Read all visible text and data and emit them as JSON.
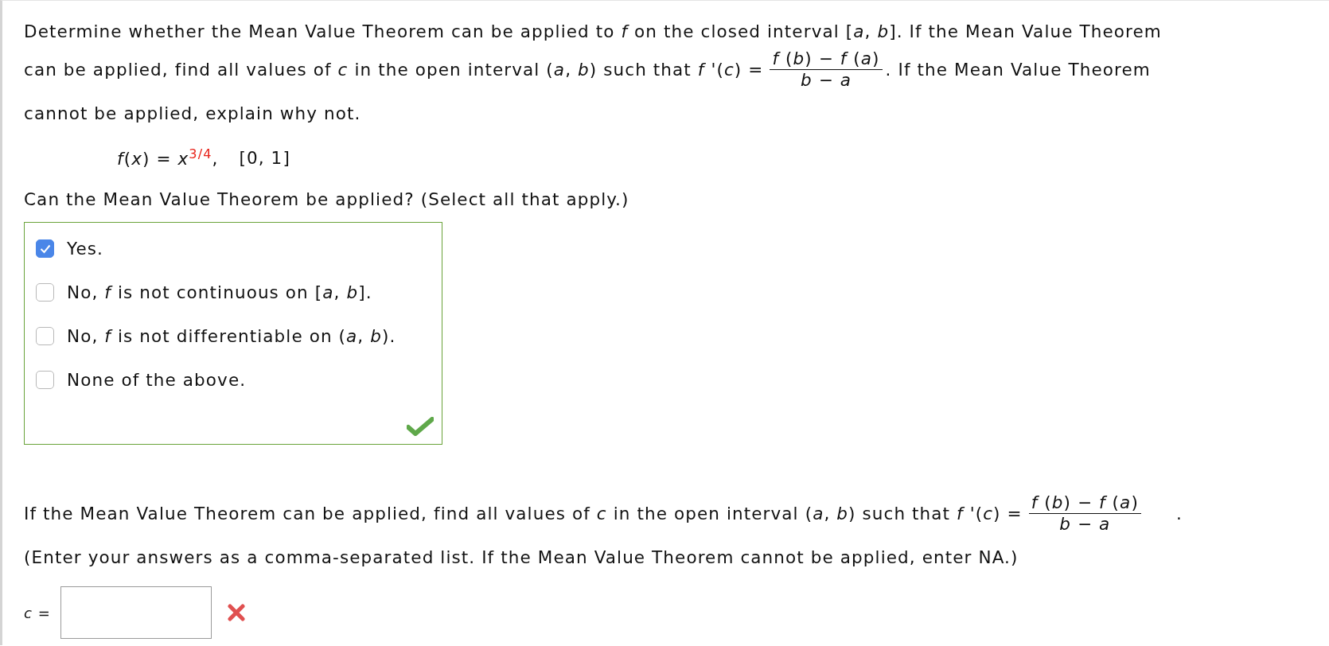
{
  "question": {
    "line_1": "Determine whether the Mean Value Theorem can be applied to *f* on the closed interval [*a*, *b*]. If the Mean Value Theorem",
    "line_2_before": "can be applied, find all values of *c* in the open interval (*a*, *b*) such that  *f* '(*c*) =",
    "fraction": {
      "numerator": "*f* (*b*) − *f* (*a*)",
      "denominator": "*b* − *a*"
    },
    "line_2_after": ".  If the Mean Value Theorem",
    "line_3": "cannot be applied, explain why not."
  },
  "function": {
    "formula": "*f*(*x*) = *x*$^{3/4}$,",
    "interval": "[0, 1]"
  },
  "part1": {
    "prompt": "Can the Mean Value Theorem be applied? (Select all that apply.)",
    "correct": true,
    "options": [
      {
        "label": "Yes.",
        "checked": true
      },
      {
        "label": "No, *f* is not continuous on [*a*, *b*].",
        "checked": false
      },
      {
        "label": "No, *f* is not differentiable on (*a*, *b*).",
        "checked": false
      },
      {
        "label": "None of the above.",
        "checked": false
      }
    ]
  },
  "part2": {
    "before": "If the Mean Value Theorem can be applied, find all values of *c* in the open interval (*a*, *b*) such that  *f* '(*c*) =",
    "fraction": {
      "numerator": "*f* (*b*) − *f* (*a*)",
      "denominator": "*b* − *a*"
    },
    "after": ".",
    "instructions": "(Enter your answers as a comma-separated list. If the Mean Value Theorem cannot be applied, enter NA.)",
    "answer_label": "*c* =",
    "correct": false
  }
}
